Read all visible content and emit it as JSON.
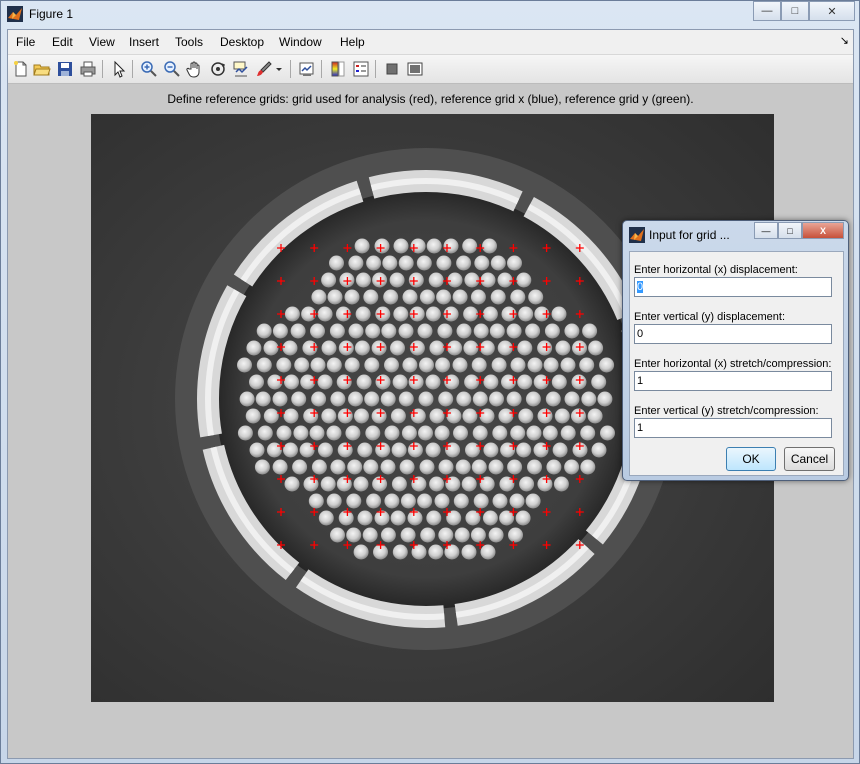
{
  "window": {
    "title": "Figure 1",
    "minimize": "—",
    "maximize": "□",
    "close": "✕"
  },
  "menu": [
    "File",
    "Edit",
    "View",
    "Insert",
    "Tools",
    "Desktop",
    "Window",
    "Help"
  ],
  "dock_arrow": "↘",
  "caption": "Define reference grids: grid used for analysis (red), reference grid x (blue), reference grid y (green).",
  "dialog": {
    "title": "Input for grid ...",
    "close": "X",
    "fields": [
      {
        "label": "Enter horizontal (x) displacement:",
        "value": "0"
      },
      {
        "label": "Enter vertical (y) displacement:",
        "value": "0"
      },
      {
        "label": "Enter horizontal (x) stretch/compression:",
        "value": "1"
      },
      {
        "label": "Enter vertical (y) stretch/compression:",
        "value": "1"
      }
    ],
    "ok": "OK",
    "cancel": "Cancel"
  },
  "colors": {
    "grid_marker": "#ff0000"
  }
}
